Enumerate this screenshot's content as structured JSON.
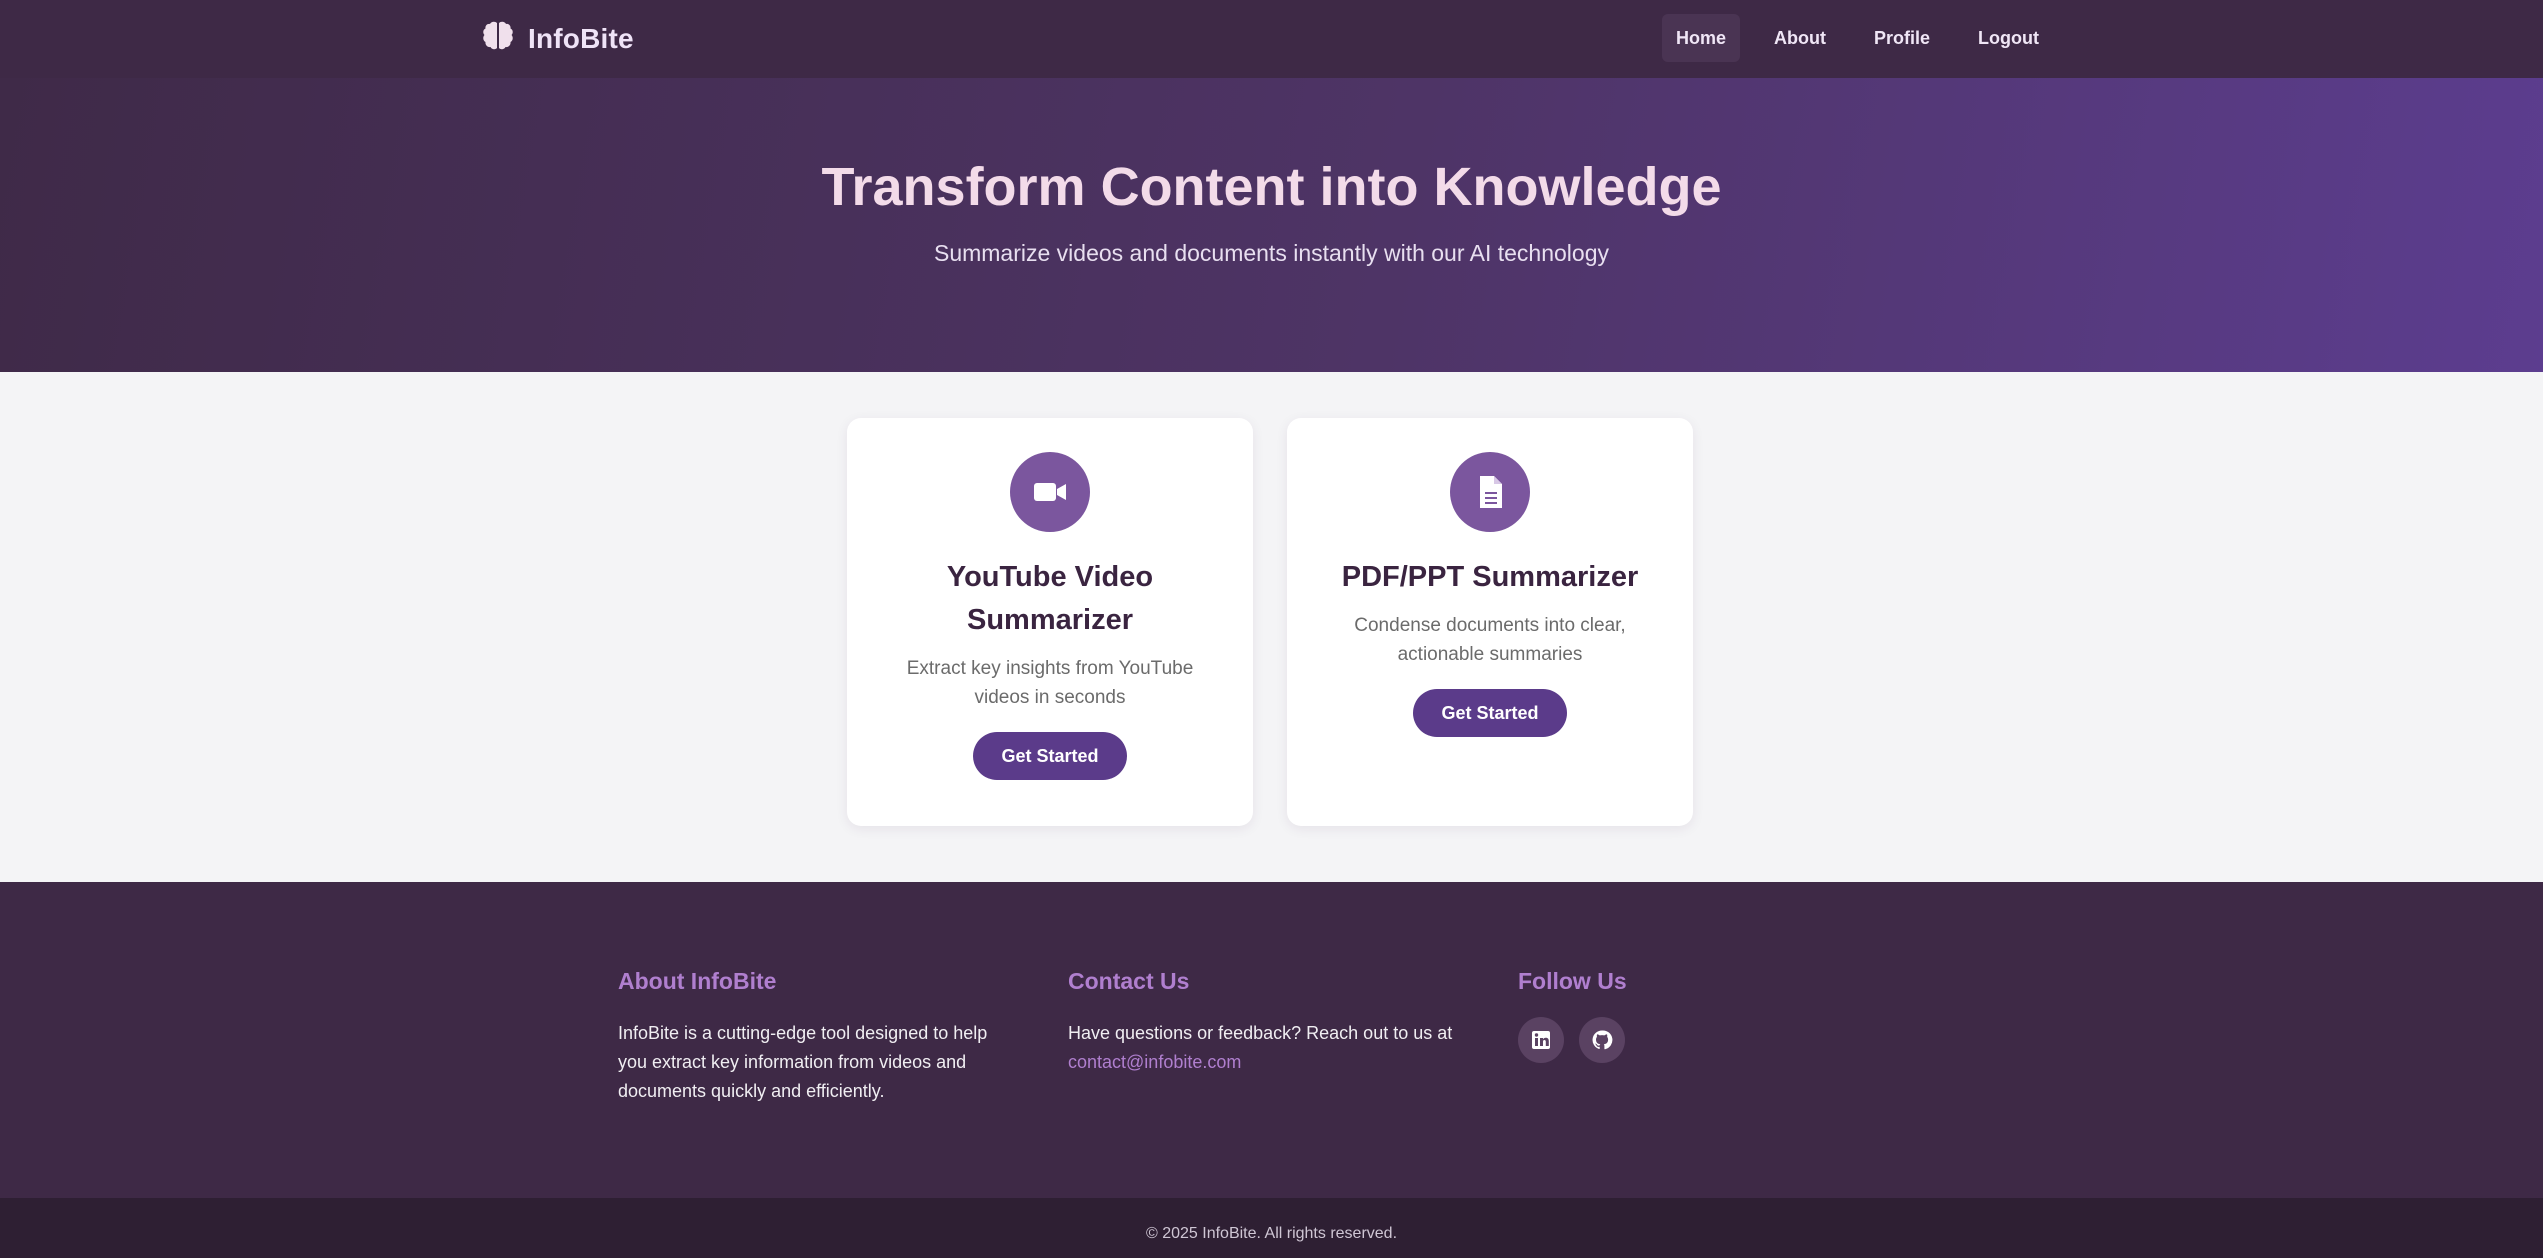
{
  "brand": {
    "name": "InfoBite",
    "icon": "brain-icon"
  },
  "nav": {
    "items": [
      {
        "label": "Home",
        "active": true
      },
      {
        "label": "About",
        "active": false
      },
      {
        "label": "Profile",
        "active": false
      },
      {
        "label": "Logout",
        "active": false
      }
    ]
  },
  "hero": {
    "title": "Transform Content into Knowledge",
    "subtitle": "Summarize videos and documents instantly with our AI technology"
  },
  "cards": [
    {
      "icon": "video-camera-icon",
      "title": "YouTube Video Summarizer",
      "description": "Extract key insights from YouTube videos in seconds",
      "button": "Get Started"
    },
    {
      "icon": "document-icon",
      "title": "PDF/PPT Summarizer",
      "description": "Condense documents into clear, actionable summaries",
      "button": "Get Started"
    }
  ],
  "footer": {
    "about": {
      "heading": "About InfoBite",
      "text": "InfoBite is a cutting-edge tool designed to help you extract key information from videos and documents quickly and efficiently."
    },
    "contact": {
      "heading": "Contact Us",
      "text": "Have questions or feedback? Reach out to us at",
      "email": "contact@infobite.com"
    },
    "follow": {
      "heading": "Follow Us",
      "icons": [
        "linkedin-icon",
        "github-icon"
      ]
    },
    "copyright": "© 2025 InfoBite. All rights reserved."
  },
  "colors": {
    "primary": "#5b3b8a",
    "dark": "#3e2946",
    "accent": "#b07fcf",
    "icon_bg": "#7b569e"
  }
}
